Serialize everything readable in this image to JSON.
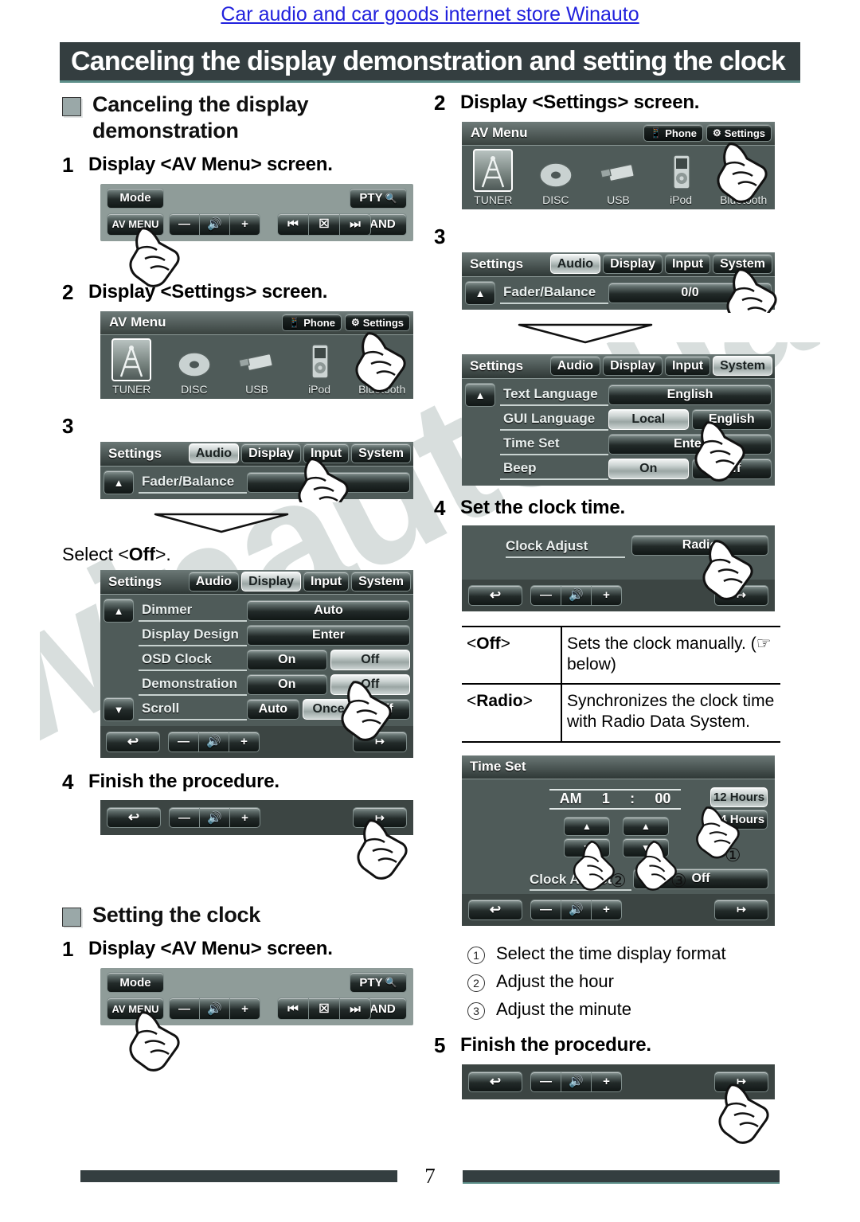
{
  "store_link": "Car audio and car goods internet store Winauto",
  "page_title": "Canceling the display demonstration and setting the clock",
  "watermark": "winauto.ua",
  "page_number": "7",
  "colors": {
    "banner_bg": "#343e40",
    "link": "#2222dd",
    "accent_rule": "#5d8f8a",
    "screen_bg": "#4f5b59"
  },
  "left": {
    "section1_title": "Canceling the display demonstration",
    "step1": {
      "num": "1",
      "text": "Display <AV Menu> screen."
    },
    "step2": {
      "num": "2",
      "text": "Display <Settings> screen."
    },
    "step3": {
      "num": "3",
      "text": ""
    },
    "select_off": "Select <Off>.",
    "select_off_plain": "Select <",
    "select_off_bold": "Off",
    "select_off_tail": ">.",
    "step4": {
      "num": "4",
      "text": "Finish the procedure."
    },
    "section2_title": "Setting the clock",
    "clock_step1": {
      "num": "1",
      "text": "Display <AV Menu> screen."
    }
  },
  "right": {
    "step2": {
      "num": "2",
      "text": "Display <Settings> screen."
    },
    "step3": {
      "num": "3",
      "text": ""
    },
    "step4": {
      "num": "4",
      "text": "Set the clock time."
    },
    "step5": {
      "num": "5",
      "text": "Finish the procedure."
    },
    "table": {
      "rows": [
        {
          "key_prefix": "<",
          "key": "Off",
          "key_suffix": ">",
          "value": "Sets the clock manually. (☞ below)"
        },
        {
          "key_prefix": "<",
          "key": "Radio",
          "key_suffix": ">",
          "value": "Synchronizes the clock time with Radio Data System."
        }
      ]
    },
    "circle_list": [
      {
        "num": "①",
        "text": "Select the time display format"
      },
      {
        "num": "②",
        "text": "Adjust the hour"
      },
      {
        "num": "③",
        "text": "Adjust the minute"
      }
    ]
  },
  "av_bar": {
    "mode": "Mode",
    "pty": "PTY",
    "av_menu": "AV MENU",
    "band": "BAND",
    "vol_minus": "—",
    "vol_icon": "🔊",
    "vol_plus": "+",
    "prev": "⏮",
    "mute": "☒",
    "next": "⏭"
  },
  "av_menu_screen": {
    "title": "AV Menu",
    "phone": "Phone",
    "settings": "Settings",
    "sources": [
      {
        "label": "TUNER",
        "icon": "tuner-icon",
        "selected": true
      },
      {
        "label": "DISC",
        "icon": "disc-icon",
        "selected": false
      },
      {
        "label": "USB",
        "icon": "usb-icon",
        "selected": false
      },
      {
        "label": "iPod",
        "icon": "ipod-icon",
        "selected": false
      },
      {
        "label": "Bluetooth",
        "icon": "bluetooth-icon",
        "selected": false
      }
    ]
  },
  "settings_audio": {
    "title": "Settings",
    "tabs": [
      "Audio",
      "Display",
      "Input",
      "System"
    ],
    "active_tab": "Audio",
    "row_label": "Fader/Balance",
    "row_value": "0/0"
  },
  "settings_display": {
    "title": "Settings",
    "tabs": [
      "Audio",
      "Display",
      "Input",
      "System"
    ],
    "active_tab": "Display",
    "rows": [
      {
        "label": "Dimmer",
        "values": [
          "Auto"
        ]
      },
      {
        "label": "Display Design",
        "values": [
          "Enter"
        ]
      },
      {
        "label": "OSD Clock",
        "values": [
          "On",
          "Off"
        ]
      },
      {
        "label": "Demonstration",
        "values": [
          "On",
          "Off"
        ]
      },
      {
        "label": "Scroll",
        "values": [
          "Auto",
          "Once",
          "Off"
        ]
      }
    ]
  },
  "settings_system": {
    "title": "Settings",
    "tabs": [
      "Audio",
      "Display",
      "Input",
      "System"
    ],
    "active_tab": "System",
    "rows": [
      {
        "label": "Text Language",
        "values": [
          "English"
        ]
      },
      {
        "label": "GUI Language",
        "values": [
          "Local",
          "English"
        ]
      },
      {
        "label": "Time Set",
        "values": [
          "Enter"
        ]
      },
      {
        "label": "Beep",
        "values": [
          "On",
          "Off"
        ]
      }
    ]
  },
  "clock_adjust_screen": {
    "label": "Clock Adjust",
    "value": "Radio"
  },
  "time_set_screen": {
    "title": "Time Set",
    "ampm": "AM",
    "hour": "1",
    "colon": ":",
    "minute": "00",
    "format_12": "12 Hours",
    "format_24": "24 Hours",
    "clock_adjust_label": "Clock Adjust",
    "clock_adjust_value": "Off",
    "callouts": [
      "①",
      "②",
      "③"
    ]
  },
  "bottom_bar": {
    "back": "↩",
    "vol_minus": "—",
    "vol_icon": "🔊",
    "vol_plus": "+",
    "exit": "exit-icon"
  }
}
